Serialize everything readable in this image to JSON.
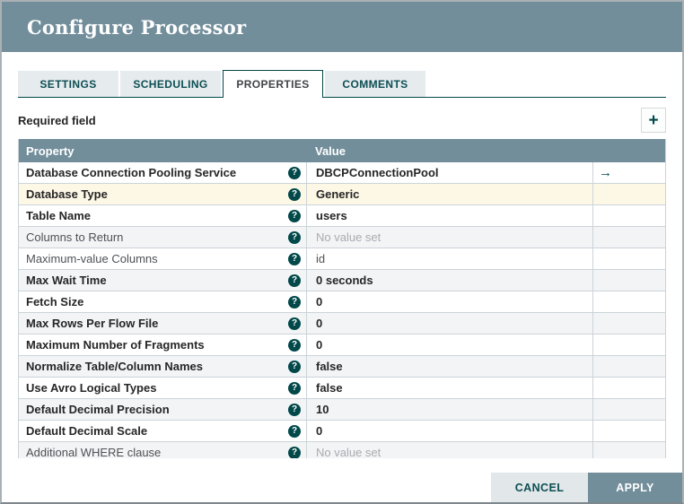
{
  "dialog": {
    "title": "Configure Processor",
    "tabs": [
      {
        "label": "SETTINGS",
        "active": false
      },
      {
        "label": "SCHEDULING",
        "active": false
      },
      {
        "label": "PROPERTIES",
        "active": true
      },
      {
        "label": "COMMENTS",
        "active": false
      }
    ],
    "required_field_label": "Required field",
    "icons": {
      "add": "plus-icon",
      "add_glyph": "+",
      "help": "question-mark-icon",
      "help_glyph": "?",
      "goto": "right-arrow-icon",
      "goto_glyph": "→"
    },
    "table": {
      "headers": {
        "property": "Property",
        "value": "Value"
      },
      "rows": [
        {
          "property": "Database Connection Pooling Service",
          "value": "DBCPConnectionPool",
          "required": true,
          "unset": false,
          "selected": false,
          "has_goto": true
        },
        {
          "property": "Database Type",
          "value": "Generic",
          "required": true,
          "unset": false,
          "selected": true,
          "has_goto": false
        },
        {
          "property": "Table Name",
          "value": "users",
          "required": true,
          "unset": false,
          "selected": false,
          "has_goto": false
        },
        {
          "property": "Columns to Return",
          "value": "No value set",
          "required": false,
          "unset": true,
          "selected": false,
          "has_goto": false
        },
        {
          "property": "Maximum-value Columns",
          "value": "id",
          "required": false,
          "unset": false,
          "selected": false,
          "has_goto": false
        },
        {
          "property": "Max Wait Time",
          "value": "0 seconds",
          "required": true,
          "unset": false,
          "selected": false,
          "has_goto": false
        },
        {
          "property": "Fetch Size",
          "value": "0",
          "required": true,
          "unset": false,
          "selected": false,
          "has_goto": false
        },
        {
          "property": "Max Rows Per Flow File",
          "value": "0",
          "required": true,
          "unset": false,
          "selected": false,
          "has_goto": false
        },
        {
          "property": "Maximum Number of Fragments",
          "value": "0",
          "required": true,
          "unset": false,
          "selected": false,
          "has_goto": false
        },
        {
          "property": "Normalize Table/Column Names",
          "value": "false",
          "required": true,
          "unset": false,
          "selected": false,
          "has_goto": false
        },
        {
          "property": "Use Avro Logical Types",
          "value": "false",
          "required": true,
          "unset": false,
          "selected": false,
          "has_goto": false
        },
        {
          "property": "Default Decimal Precision",
          "value": "10",
          "required": true,
          "unset": false,
          "selected": false,
          "has_goto": false
        },
        {
          "property": "Default Decimal Scale",
          "value": "0",
          "required": true,
          "unset": false,
          "selected": false,
          "has_goto": false
        },
        {
          "property": "Additional WHERE clause",
          "value": "No value set",
          "required": false,
          "unset": true,
          "selected": false,
          "has_goto": false
        }
      ]
    },
    "buttons": {
      "cancel": "CANCEL",
      "apply": "APPLY"
    },
    "colors": {
      "accent_teal": "#004849",
      "header_slate": "#728e9b",
      "selected_row": "#fdf7e6",
      "alt_row": "#f2f4f6"
    }
  }
}
